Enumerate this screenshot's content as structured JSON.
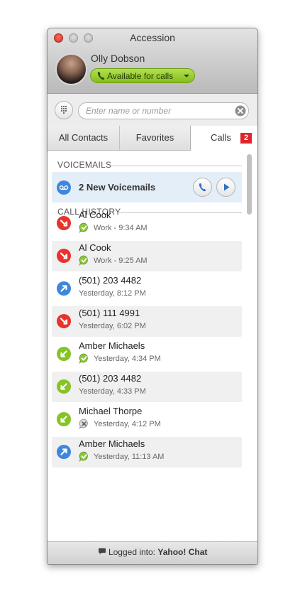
{
  "window": {
    "title": "Accession"
  },
  "user": {
    "name": "Olly Dobson",
    "status_label": "Available for calls"
  },
  "search": {
    "placeholder": "Enter name or number",
    "value": ""
  },
  "tabs": [
    {
      "label": "All Contacts"
    },
    {
      "label": "Favorites"
    },
    {
      "label": "Calls",
      "badge": "2",
      "active": true
    }
  ],
  "voicemails": {
    "heading": "VOICEMAILS",
    "label": "2 New Voicemails"
  },
  "call_history": {
    "heading": "CALL HISTORY",
    "items": [
      {
        "name": "Al Cook",
        "detail": "Work - 9:34 AM",
        "direction": "missed",
        "presence": "available"
      },
      {
        "name": "Al Cook",
        "detail": "Work - 9:25 AM",
        "direction": "missed",
        "presence": "available"
      },
      {
        "name": "(501) 203 4482",
        "detail": "Yesterday, 8:12 PM",
        "direction": "outgoing",
        "presence": "none"
      },
      {
        "name": "(501) 111 4991",
        "detail": "Yesterday, 6:02 PM",
        "direction": "missed",
        "presence": "none"
      },
      {
        "name": "Amber Michaels",
        "detail": "Yesterday, 4:34 PM",
        "direction": "incoming",
        "presence": "available"
      },
      {
        "name": "(501) 203 4482",
        "detail": "Yesterday, 4:33 PM",
        "direction": "incoming",
        "presence": "none"
      },
      {
        "name": "Michael Thorpe",
        "detail": "Yesterday, 4:12 PM",
        "direction": "incoming",
        "presence": "offline"
      },
      {
        "name": "Amber Michaels",
        "detail": "Yesterday, 11:13 AM",
        "direction": "outgoing",
        "presence": "available"
      }
    ]
  },
  "footer": {
    "prefix": "Logged into:",
    "service": "Yahoo! Chat"
  },
  "colors": {
    "missed": "#e8322b",
    "outgoing": "#3f86dd",
    "incoming": "#86c325",
    "status_green": "#8dc63f",
    "voicemail_row": "#e4eef8",
    "badge": "#e0242a"
  },
  "icons": {
    "missed": "arrow-missed-icon",
    "outgoing": "arrow-outgoing-icon",
    "incoming": "arrow-incoming-icon",
    "available": "presence-available-icon",
    "offline": "presence-offline-icon"
  }
}
